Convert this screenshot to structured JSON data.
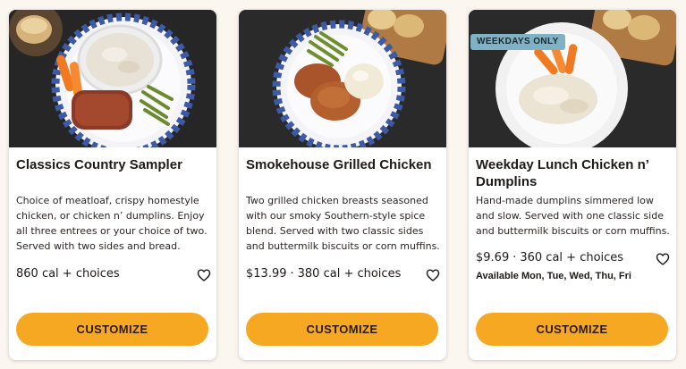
{
  "cards": [
    {
      "title": "Classics Country Sampler",
      "description": "Choice of meatloaf, crispy homestyle chicken, or chicken n’ dumplins. Enjoy all three entrees or your choice of two. Served with two sides and bread.",
      "price": "",
      "calories": "860 cal + choices",
      "availability": "",
      "badge": "",
      "button_label": "CUSTOMIZE",
      "favorite_icon": "heart-outline-icon"
    },
    {
      "title": "Smokehouse Grilled Chicken",
      "description": "Two grilled chicken breasts seasoned with our smoky Southern-style spice blend. Served with two classic sides and buttermilk biscuits or corn muffins.",
      "price": "$13.99",
      "separator": "·",
      "calories": "380 cal + choices",
      "availability": "",
      "badge": "",
      "button_label": "CUSTOMIZE",
      "favorite_icon": "heart-outline-icon"
    },
    {
      "title": "Weekday Lunch Chicken n’ Dumplins",
      "description": "Hand-made dumplins simmered low and slow. Served with one classic side and buttermilk biscuits or corn muffins.",
      "price": "$9.69",
      "separator": "·",
      "calories": "360 cal + choices",
      "availability": "Available Mon, Tue, Wed, Thu, Fri",
      "badge": "WEEKDAYS ONLY",
      "button_label": "CUSTOMIZE",
      "favorite_icon": "heart-outline-icon"
    }
  ],
  "colors": {
    "page_background": "#fbf6ef",
    "button": "#f6a822",
    "badge": "#7fb2c4",
    "text": "#1f1a17"
  }
}
